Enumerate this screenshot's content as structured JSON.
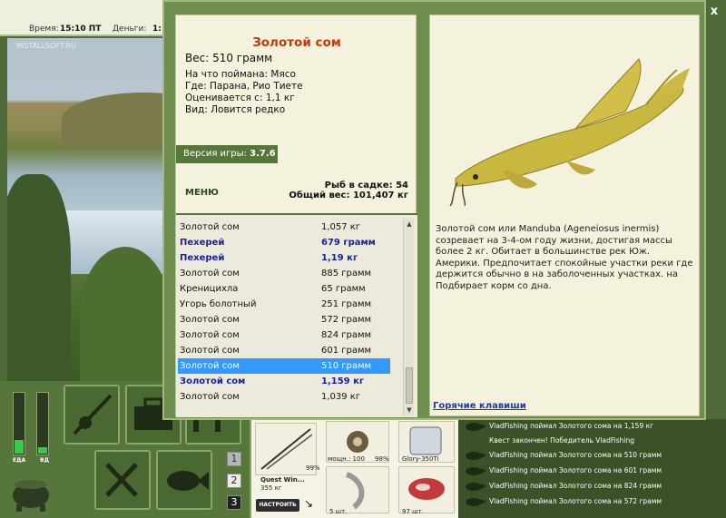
{
  "status_bar": {
    "time_label": "Время:",
    "time_value": "15:10 ПТ",
    "money_label": "Деньги:",
    "money_value": "1:"
  },
  "watermark": "INSTALLSOFT.RU",
  "gauges": {
    "food_label": "ЕДА",
    "energy_label": "ВД",
    "food_level": 0.22,
    "energy_level": 0.1
  },
  "page_buttons": [
    "1",
    "2",
    "3"
  ],
  "inventory": {
    "rod_name": "Quest Win...",
    "rod_weight": "355 кг",
    "rod_percent": "99%",
    "reel_label": "мощн.: 100",
    "reel_percent": "98%",
    "line_name": "Glory-350Ti",
    "lure_count": "5 шт.",
    "bait_count": "97 шт.",
    "setup_button": "НАСТРОИТЬ"
  },
  "feed": [
    "VladFishing поймал Золотого сома на 1,159 кг",
    "Квест закончен! Победитель VladFishing",
    "VladFishing поймал Золотого сома на 510 грамм",
    "VladFishing поймал Золотого сома на 601 грамм",
    "VladFishing поймал Золотого сома на 824 грамм",
    "VladFishing поймал Золотого сома на 572 грамм"
  ],
  "close_label": "x",
  "fish": {
    "title": "Золотой сом",
    "weight": "Вес: 510 грамм",
    "bait": "На что поймана: Мясо",
    "location": "Где: Парана, Рио Тиете",
    "valued_from": "Оценивается с: 1,1 кг",
    "rarity": "Вид: Ловится редко",
    "description": "Золотой сом или Manduba (Ageneiosus inermis) созревает на 3-4-ом году жизни, достигая массы более 2 кг. Обитает в большинстве рек Юж. Америки. Предпочитает спокойные участки реки где держится обычно в на заболоченных участках. на Подбирает корм со дна."
  },
  "version": {
    "label": "Версия игры: ",
    "value": "3.7.6"
  },
  "menu_label": "МЕНЮ",
  "keep_net": {
    "count": "Рыб в садке: 54",
    "total": "Общий вес: 101,407 кг"
  },
  "catch_list": [
    {
      "name": "Золотой сом",
      "weight": "1,057 кг",
      "style": "normal"
    },
    {
      "name": "Пехерей",
      "weight": "679 грамм",
      "style": "highlight"
    },
    {
      "name": "Пехерей",
      "weight": "1,19 кг",
      "style": "highlight"
    },
    {
      "name": "Золотой сом",
      "weight": "885 грамм",
      "style": "normal"
    },
    {
      "name": "Креницихла",
      "weight": "65 грамм",
      "style": "normal"
    },
    {
      "name": "Угорь болотный",
      "weight": "251 грамм",
      "style": "normal"
    },
    {
      "name": "Золотой сом",
      "weight": "572 грамм",
      "style": "normal"
    },
    {
      "name": "Золотой сом",
      "weight": "824 грамм",
      "style": "normal"
    },
    {
      "name": "Золотой сом",
      "weight": "601 грамм",
      "style": "normal"
    },
    {
      "name": "Золотой сом",
      "weight": "510 грамм",
      "style": "selected"
    },
    {
      "name": "Золотой сом",
      "weight": "1,159 кг",
      "style": "highlight"
    },
    {
      "name": "Золотой сом",
      "weight": "1,039 кг",
      "style": "normal"
    }
  ],
  "hotkeys_label": "Горячие клавиши",
  "colors": {
    "title_red": "#c0390f",
    "highlight_blue": "#1a22a0",
    "selection": "#3399ff",
    "frame_green": "#6d8e4c"
  }
}
